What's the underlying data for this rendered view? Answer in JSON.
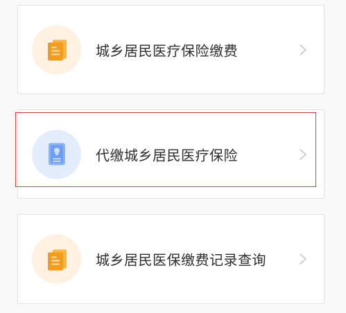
{
  "menu": {
    "items": [
      {
        "label": "城乡居民医疗保险缴费",
        "icon": "document-icon",
        "icon_color": "#f5a623",
        "bg_color": "#fff1df"
      },
      {
        "label": "代缴城乡居民医疗保险",
        "icon": "id-card-icon",
        "icon_color": "#6d9ef0",
        "bg_color": "#e3edfb"
      },
      {
        "label": "城乡居民医保缴费记录查询",
        "icon": "document-icon",
        "icon_color": "#f5a623",
        "bg_color": "#fff1df"
      }
    ]
  },
  "highlight": {
    "color": "#d4453f",
    "target": "代缴城乡居民医疗保险"
  },
  "colors": {
    "text": "#2d2d2d",
    "chevron": "#c8c8c8",
    "card_border": "#e1e1e1"
  }
}
